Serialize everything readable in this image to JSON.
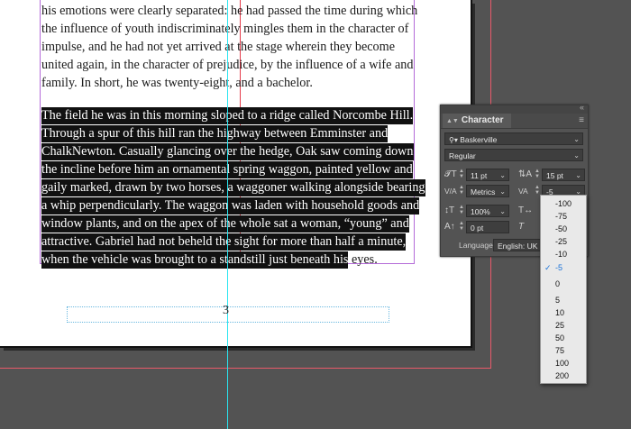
{
  "document": {
    "paragraph1": [
      "his emotions were clearly separated: he had passed the time during which",
      "the influence of youth indiscriminately mingles them in the character of",
      "impulse, and he had not yet arrived at the stage wherein they become",
      "united again, in the character of prejudice, by the influence of a wife and",
      "family. In short, he was twenty-eight, and a bachelor."
    ],
    "paragraph2_selected": [
      "The field he was in this morning sloped to a ridge called Norcombe Hill.",
      "Through a spur of this hill ran the highway between Emminster and",
      "ChalkNewton. Casually glancing over the hedge, Oak saw coming down",
      "the incline before him an ornamental spring waggon, painted yellow and",
      "gaily marked, drawn by two horses, a waggoner walking alongside bearing",
      "a whip perpendicularly. The waggon was laden with household goods and",
      "window plants, and on the apex of the whole sat a woman, “young” and",
      "attractive. Gabriel had not beheld the sight for more than half a minute,",
      "when the vehicle was brought to a standstill just beneath his"
    ],
    "paragraph2_tail": "eyes.",
    "page_number": "3"
  },
  "panel": {
    "title": "Character",
    "font_family": "Baskerville",
    "font_style": "Regular",
    "font_size": "11 pt",
    "leading": "15 pt",
    "kerning": "Metrics",
    "tracking": "-5",
    "vertical_scale": "100%",
    "baseline_shift": "0 pt",
    "language_label": "Language:",
    "language_value": "English: UK"
  },
  "tracking_menu": {
    "options": [
      "-100",
      "-75",
      "-50",
      "-25",
      "-10",
      "-5",
      "0",
      "5",
      "10",
      "25",
      "50",
      "75",
      "100",
      "200"
    ],
    "selected": "-5"
  },
  "colors": {
    "selection": "#111111",
    "frame": "#b46ad8",
    "guide_cyan": "#29e5f0",
    "bleed": "#e85a6a",
    "menu_selected": "#1a73d9"
  }
}
